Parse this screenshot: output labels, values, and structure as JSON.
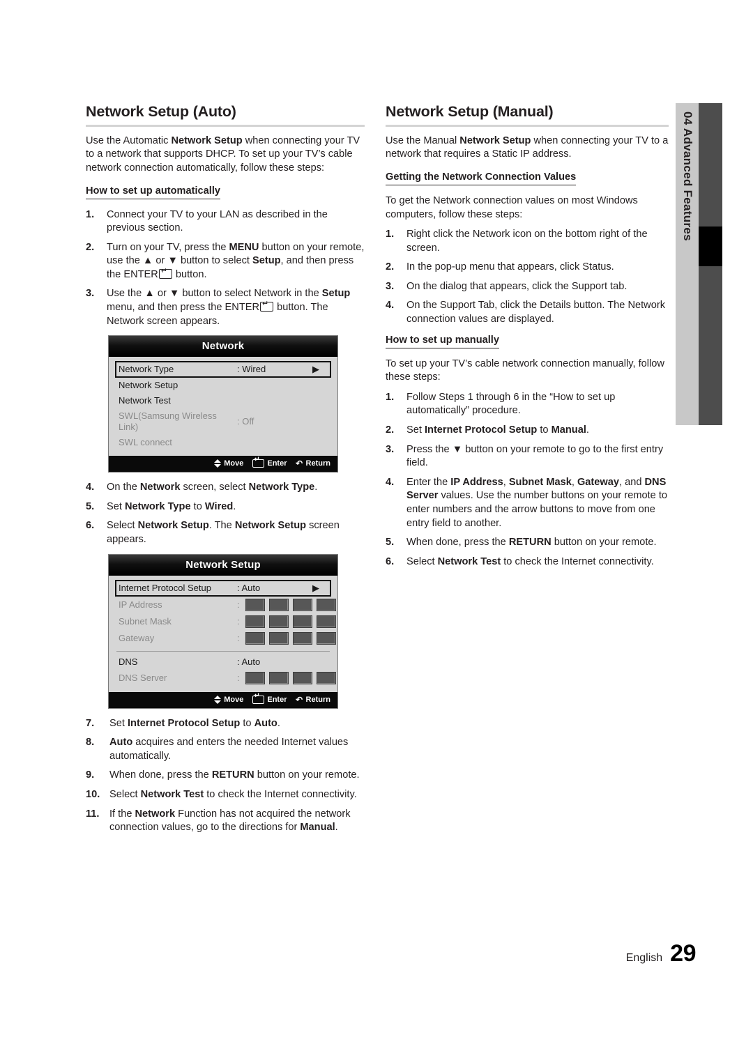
{
  "chapter_tab": {
    "number": "04",
    "label": "Advanced Features",
    "full_label": "04  Advanced Features"
  },
  "footer": {
    "language": "English",
    "page_number": "29"
  },
  "left_column": {
    "title": "Network Setup (Auto)",
    "intro": "Use the Automatic Network Setup when connecting your TV to a network that supports DHCP. To set up your TV's cable network connection automatically, follow these steps:",
    "subhead": "How to set up automatically",
    "steps_1_3": [
      {
        "num": "1.",
        "text": "Connect your TV to your LAN as described in the previous section."
      },
      {
        "num": "2.",
        "text": "Turn on your TV, press the MENU button on your remote, use the ▲ or ▼ button to select Setup, and then press the ENTER button."
      },
      {
        "num": "3.",
        "text": "Use the ▲ or ▼ button to select Network in the Setup menu, and then press the ENTER button. The Network screen appears."
      }
    ],
    "steps_4_6": [
      {
        "num": "4.",
        "text": "On the Network screen, select Network Type."
      },
      {
        "num": "5.",
        "text": "Set Network Type to Wired."
      },
      {
        "num": "6.",
        "text": "Select Network Setup. The Network Setup screen appears."
      }
    ],
    "steps_7_11": [
      {
        "num": "7.",
        "text": "Set Internet Protocol Setup to Auto."
      },
      {
        "num": "8.",
        "text": "Auto acquires and enters the needed Internet values automatically."
      },
      {
        "num": "9.",
        "text": "When done, press the RETURN button on your remote."
      },
      {
        "num": "10.",
        "text": "Select Network Test to check the Internet connectivity."
      },
      {
        "num": "11.",
        "text": "If the Network Function has not acquired the network connection values, go to the directions for Manual."
      }
    ]
  },
  "right_column": {
    "title": "Network Setup (Manual)",
    "intro": "Use the Manual Network Setup when connecting your TV to a network that requires a Static IP address.",
    "subhead_1": "Getting the Network Connection Values",
    "intro_2": "To get the Network connection values on most Windows computers, follow these steps:",
    "steps_values": [
      {
        "num": "1.",
        "text": "Right click the Network icon on the bottom right of the screen."
      },
      {
        "num": "2.",
        "text": "In the pop-up menu that appears, click Status."
      },
      {
        "num": "3.",
        "text": "On the dialog that appears, click the Support tab."
      },
      {
        "num": "4.",
        "text": "On the Support Tab, click the Details button. The Network connection values are displayed."
      }
    ],
    "subhead_2": "How to set up manually",
    "intro_3": "To set up your TV's cable network connection manually, follow these steps:",
    "steps_manual": [
      {
        "num": "1.",
        "text": "Follow Steps 1 through 6 in the “How to set up automatically” procedure."
      },
      {
        "num": "2.",
        "text": "Set Internet Protocol Setup to Manual."
      },
      {
        "num": "3.",
        "text": "Press the ▼ button on your remote to go to the first entry field."
      },
      {
        "num": "4.",
        "text": "Enter the IP Address, Subnet Mask, Gateway, and DNS Server values. Use the number buttons on your remote to enter numbers and the arrow buttons to move from one entry field to another."
      },
      {
        "num": "5.",
        "text": "When done, press the RETURN button on your remote."
      },
      {
        "num": "6.",
        "text": "Select Network Test to check the Internet connectivity."
      }
    ]
  },
  "osd_network": {
    "title": "Network",
    "rows": [
      {
        "label": "Network Type",
        "value": ": Wired",
        "arrow": "▶",
        "selected": true,
        "dim": false
      },
      {
        "label": "Network Setup",
        "value": "",
        "arrow": "",
        "selected": false,
        "dim": false
      },
      {
        "label": "Network Test",
        "value": "",
        "arrow": "",
        "selected": false,
        "dim": false
      },
      {
        "label": "SWL(Samsung Wireless Link)",
        "value": ": Off",
        "arrow": "",
        "selected": false,
        "dim": true
      },
      {
        "label": "SWL connect",
        "value": "",
        "arrow": "",
        "selected": false,
        "dim": true
      }
    ],
    "footer_hints": [
      {
        "icon": "move-icon",
        "label": "Move"
      },
      {
        "icon": "enter-icon",
        "label": "Enter"
      },
      {
        "icon": "return-icon",
        "label": "Return"
      }
    ]
  },
  "osd_network_setup": {
    "title": "Network Setup",
    "rows": [
      {
        "label": "Internet Protocol Setup",
        "value": ": Auto",
        "arrow": "▶",
        "selected": true,
        "dim": false,
        "boxes": 0
      },
      {
        "label": "IP Address",
        "value": ":",
        "arrow": "",
        "selected": false,
        "dim": true,
        "boxes": 4
      },
      {
        "label": "Subnet Mask",
        "value": ":",
        "arrow": "",
        "selected": false,
        "dim": true,
        "boxes": 4
      },
      {
        "label": "Gateway",
        "value": ":",
        "arrow": "",
        "selected": false,
        "dim": true,
        "boxes": 4
      },
      {
        "label": "DNS",
        "value": ": Auto",
        "arrow": "",
        "selected": false,
        "dim": false,
        "boxes": 0
      },
      {
        "label": "DNS Server",
        "value": ":",
        "arrow": "",
        "selected": false,
        "dim": true,
        "boxes": 4
      }
    ],
    "footer_hints": [
      {
        "icon": "move-icon",
        "label": "Move"
      },
      {
        "icon": "enter-icon",
        "label": "Enter"
      },
      {
        "icon": "return-icon",
        "label": "Return"
      }
    ]
  }
}
